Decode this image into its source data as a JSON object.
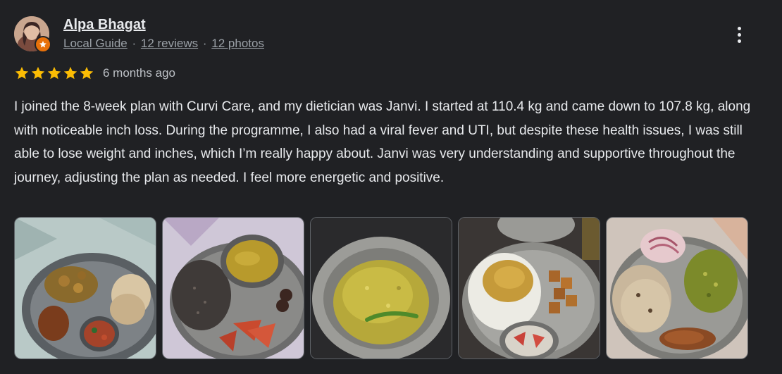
{
  "reviewer": {
    "name": "Alpa Bhagat",
    "level": "Local Guide",
    "reviews_count": "12 reviews",
    "photos_count": "12 photos",
    "separator": "·"
  },
  "review": {
    "rating": 5,
    "max_rating": 5,
    "time": "6 months ago",
    "text": "I joined the 8-week plan with Curvi Care, and my dietician was Janvi. I started at 110.4 kg and came down to 107.8 kg, along with noticeable inch loss. During the programme, I also had a viral fever and UTI, but despite these health issues, I was still able to lose weight and inches, which I’m really happy about. Janvi was very understanding and supportive throughout the journey, adjusting the plan as needed. I feel more energetic and positive."
  },
  "icons": {
    "more": "more-vert-icon",
    "badge": "local-guide-badge-icon",
    "star": "star-icon"
  },
  "colors": {
    "background": "#202124",
    "text": "#e8eaed",
    "muted": "#9aa0a6",
    "star": "#fbbc04",
    "badge": "#e8710a"
  }
}
